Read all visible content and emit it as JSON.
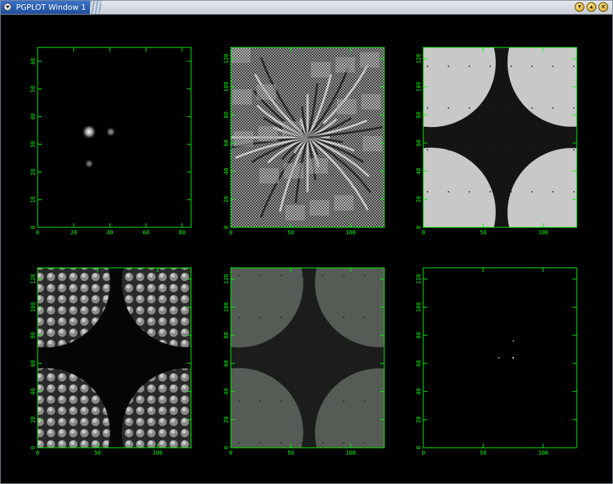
{
  "window": {
    "title": "PGPLOT Window 1",
    "colors": {
      "axis": "#00ff00",
      "background": "#000000"
    },
    "icons": [
      "menu-icon",
      "minimize-icon",
      "maximize-icon",
      "close-icon"
    ]
  },
  "panels": [
    {
      "kind": "spots",
      "x_ticks": [
        "0",
        "20",
        "40",
        "60",
        "80"
      ],
      "y_ticks": [
        "0",
        "10",
        "20",
        "30",
        "40",
        "50",
        "60"
      ],
      "xlim": [
        0,
        85
      ],
      "ylim": [
        0,
        65
      ]
    },
    {
      "kind": "noise",
      "x_ticks": [
        "0",
        "50",
        "100"
      ],
      "y_ticks": [
        "0",
        "20",
        "40",
        "60",
        "80",
        "100",
        "120"
      ],
      "xlim": [
        0,
        128
      ],
      "ylim": [
        0,
        128
      ]
    },
    {
      "kind": "gear-bright",
      "x_ticks": [
        "0",
        "50",
        "100"
      ],
      "y_ticks": [
        "0",
        "20",
        "40",
        "60",
        "80",
        "100",
        "120"
      ],
      "xlim": [
        0,
        128
      ],
      "ylim": [
        0,
        128
      ]
    },
    {
      "kind": "gear-textured",
      "x_ticks": [
        "0",
        "50",
        "100"
      ],
      "y_ticks": [
        "0",
        "20",
        "40",
        "60",
        "80",
        "100",
        "120"
      ],
      "xlim": [
        0,
        128
      ],
      "ylim": [
        0,
        128
      ]
    },
    {
      "kind": "gear-gray",
      "x_ticks": [
        "0",
        "50",
        "100"
      ],
      "y_ticks": [
        "0",
        "20",
        "40",
        "60",
        "80",
        "100",
        "120"
      ],
      "xlim": [
        0,
        128
      ],
      "ylim": [
        0,
        128
      ]
    },
    {
      "kind": "points",
      "x_ticks": [
        "0",
        "50",
        "100"
      ],
      "y_ticks": [
        "0",
        "20",
        "40",
        "60",
        "80",
        "100",
        "120"
      ],
      "xlim": [
        0,
        128
      ],
      "ylim": [
        0,
        128
      ]
    }
  ]
}
